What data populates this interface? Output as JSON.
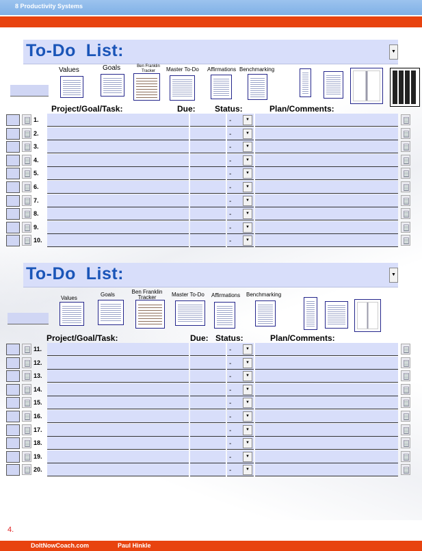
{
  "header": {
    "app_title": "8 Productivity Systems"
  },
  "section1": {
    "title": "To-Do  List:",
    "thumbs": [
      "Values",
      "Goals",
      "Ben Franklin Tracker",
      "Master To-Do",
      "Affirmations",
      "Benchmarking"
    ],
    "columns": {
      "task": "Project/Goal/Task:",
      "due": "Due:",
      "status": "Status:",
      "plan": "Plan/Comments:"
    },
    "rows": [
      {
        "num": "1.",
        "status": "-"
      },
      {
        "num": "2.",
        "status": "-"
      },
      {
        "num": "3.",
        "status": "-"
      },
      {
        "num": "4.",
        "status": "-"
      },
      {
        "num": "5.",
        "status": "-"
      },
      {
        "num": "6.",
        "status": "-"
      },
      {
        "num": "7.",
        "status": "-"
      },
      {
        "num": "8.",
        "status": "-"
      },
      {
        "num": "9.",
        "status": "-"
      },
      {
        "num": "10.",
        "status": "-"
      }
    ]
  },
  "section2": {
    "title": "To-Do  List:",
    "thumbs": [
      "Values",
      "Goals",
      "Ben Franklin Tracker",
      "Master To-Do",
      "Affirmations",
      "Benchmarking"
    ],
    "columns": {
      "task": "Project/Goal/Task:",
      "due": "Due:",
      "status": "Status:",
      "plan": "Plan/Comments:"
    },
    "rows": [
      {
        "num": "11.",
        "status": "-"
      },
      {
        "num": "12.",
        "status": "-"
      },
      {
        "num": "13.",
        "status": "-"
      },
      {
        "num": "14.",
        "status": "-"
      },
      {
        "num": "15.",
        "status": "-"
      },
      {
        "num": "16.",
        "status": "-"
      },
      {
        "num": "17.",
        "status": "-"
      },
      {
        "num": "18.",
        "status": "-"
      },
      {
        "num": "19.",
        "status": "-"
      },
      {
        "num": "20.",
        "status": "-"
      }
    ]
  },
  "footer": {
    "page_number": "4.",
    "site": "DoItNowCoach.com",
    "author": "Paul Hinkle"
  },
  "colors": {
    "accent": "#e8430f",
    "title_blue": "#1a55b8",
    "field_fill": "#d8defa",
    "topbar": "#9cc3ee"
  }
}
